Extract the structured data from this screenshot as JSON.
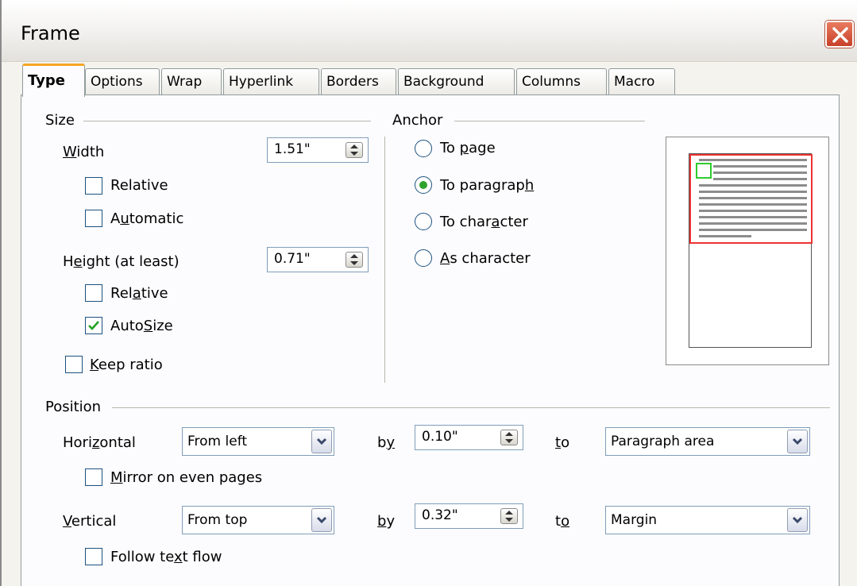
{
  "window": {
    "title": "Frame"
  },
  "tabs": [
    "Type",
    "Options",
    "Wrap",
    "Hyperlink",
    "Borders",
    "Background",
    "Columns",
    "Macro"
  ],
  "size": {
    "label": "Size",
    "width_label": "Width",
    "width_value": "1.51\"",
    "width_relative": "Relative",
    "width_automatic": "Automatic",
    "height_label": "Height (at least)",
    "height_value": "0.71\"",
    "height_relative": "Relative",
    "height_autosize": "AutoSize",
    "keep_ratio": "Keep ratio"
  },
  "anchor": {
    "label": "Anchor",
    "to_page": "To page",
    "to_paragraph": "To paragraph",
    "to_character": "To character",
    "as_character": "As character"
  },
  "position": {
    "label": "Position",
    "horizontal_label": "Horizontal",
    "horizontal_value": "From left",
    "by_label": "by",
    "horizontal_by": "0.10\"",
    "to_label": "to",
    "horizontal_to": "Paragraph area",
    "mirror": "Mirror on even pages",
    "vertical_label": "Vertical",
    "vertical_value": "From top",
    "vertical_by": "0.32\"",
    "vertical_to": "Margin",
    "follow": "Follow text flow"
  },
  "colors": {
    "frame_outline": "#e33333",
    "anchor_marker": "#2ecc2e",
    "active_tab_accent": "#f5a623",
    "close_button": "#d45538"
  },
  "icons": [
    "close-icon",
    "spin-arrows-icon",
    "dropdown-arrow-icon",
    "checkmark-icon"
  ]
}
